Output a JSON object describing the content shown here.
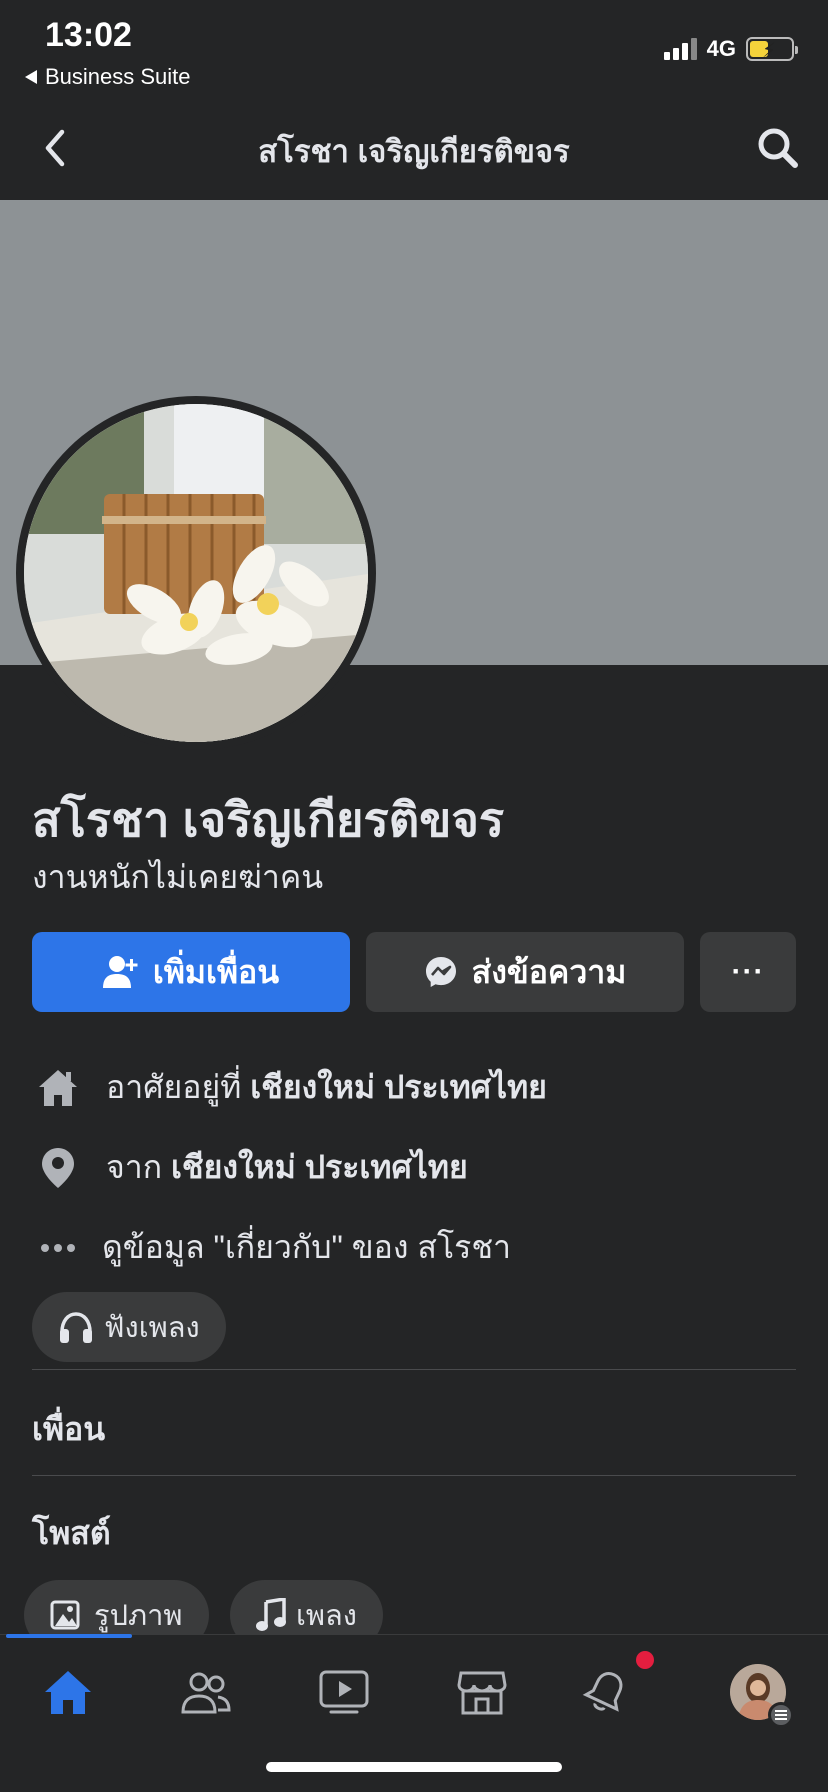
{
  "status_bar": {
    "time": "13:02",
    "back_app": "Business Suite",
    "network": "4G",
    "battery_level": 0.45,
    "battery_color": "#f5d33b"
  },
  "nav": {
    "title": "สโรชา เจริญเกียรติขจร",
    "back_icon": "chevron-left-icon",
    "search_icon": "search-icon"
  },
  "profile": {
    "name": "สโรชา เจริญเกียรติขจร",
    "bio": "งานหนักไม่เคยฆ่าคน"
  },
  "actions": {
    "add_friend": "เพิ่มเพื่อน",
    "message": "ส่งข้อความ",
    "more": "···"
  },
  "details": {
    "lives_in_prefix": "อาศัยอยู่ที่ ",
    "lives_in_place": "เชียงใหม่ ประเทศไทย",
    "from_prefix": "จาก ",
    "from_place": "เชียงใหม่ ประเทศไทย",
    "about": "ดูข้อมูล \"เกี่ยวกับ\" ของ สโรชา",
    "music_chip": "ฟังเพลง"
  },
  "sections": {
    "friends": "เพื่อน",
    "posts": "โพสต์"
  },
  "post_filters": {
    "photos": "รูปภาพ",
    "music": "เพลง"
  },
  "tab_bar": {
    "accent": "#2d75e8",
    "items": [
      "home-icon",
      "friends-icon",
      "watch-icon",
      "marketplace-icon",
      "notifications-icon",
      "profile-avatar"
    ],
    "active": "home"
  }
}
